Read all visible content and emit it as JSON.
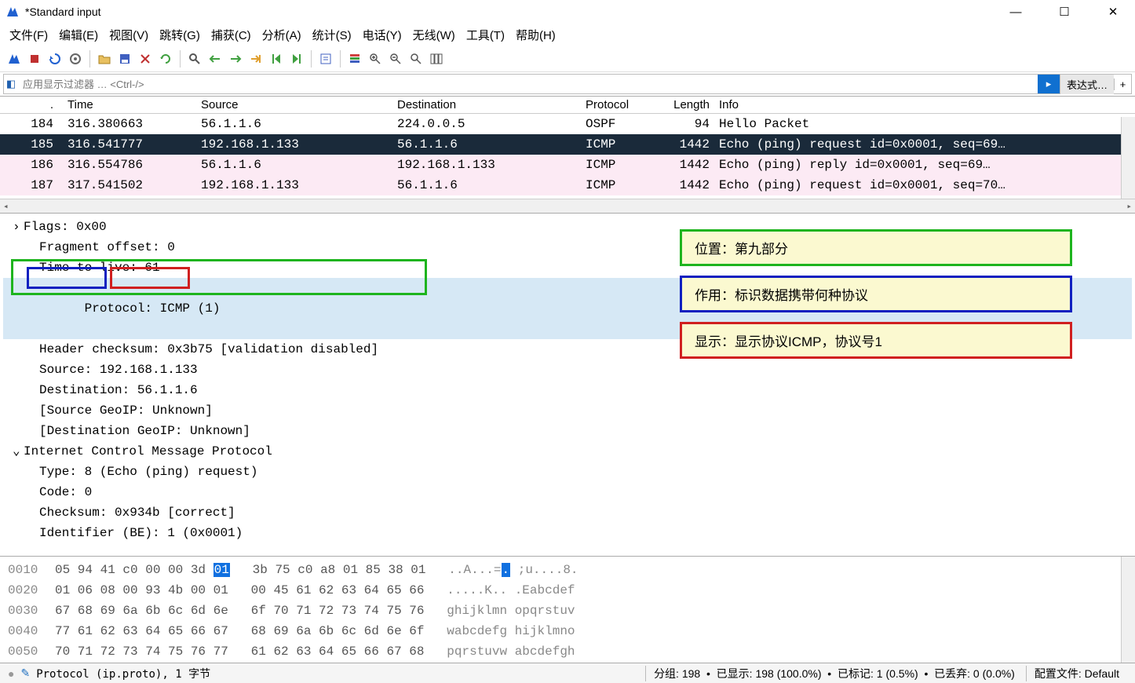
{
  "window": {
    "title": "*Standard input"
  },
  "menu": {
    "file": "文件(F)",
    "edit": "编辑(E)",
    "view": "视图(V)",
    "goto": "跳转(G)",
    "capture": "捕获(C)",
    "analyze": "分析(A)",
    "stats": "统计(S)",
    "telephony": "电话(Y)",
    "wireless": "无线(W)",
    "tools": "工具(T)",
    "help": "帮助(H)"
  },
  "filter": {
    "placeholder": "应用显示过滤器 … <Ctrl-/>",
    "expression": "表达式…"
  },
  "columns": {
    "no": "No.",
    "time": "Time",
    "source": "Source",
    "destination": "Destination",
    "protocol": "Protocol",
    "length": "Length",
    "info": "Info"
  },
  "packets": [
    {
      "no": "184",
      "time": "316.380663",
      "src": "56.1.1.6",
      "dst": "224.0.0.5",
      "proto": "OSPF",
      "len": "94",
      "info": "Hello Packet",
      "cls": "ospf"
    },
    {
      "no": "185",
      "time": "316.541777",
      "src": "192.168.1.133",
      "dst": "56.1.1.6",
      "proto": "ICMP",
      "len": "1442",
      "info": "Echo (ping) request  id=0x0001, seq=69…",
      "cls": "selected"
    },
    {
      "no": "186",
      "time": "316.554786",
      "src": "56.1.1.6",
      "dst": "192.168.1.133",
      "proto": "ICMP",
      "len": "1442",
      "info": "Echo (ping) reply    id=0x0001, seq=69…",
      "cls": "icmp"
    },
    {
      "no": "187",
      "time": "317.541502",
      "src": "192.168.1.133",
      "dst": "56.1.1.6",
      "proto": "ICMP",
      "len": "1442",
      "info": "Echo (ping) request  id=0x0001, seq=70…",
      "cls": "icmp"
    }
  ],
  "details": {
    "flags": "Flags: 0x00",
    "frag": "Fragment offset: 0",
    "ttl": "Time to live: 61",
    "proto_label": "Protocol: ",
    "proto_value": "ICMP (1)",
    "checksum": "Header checksum: 0x3b75 [validation disabled]",
    "source": "Source: 192.168.1.133",
    "dest": "Destination: 56.1.1.6",
    "srcgeo": "[Source GeoIP: Unknown]",
    "dstgeo": "[Destination GeoIP: Unknown]",
    "icmp_header": "Internet Control Message Protocol",
    "icmp_type": "Type: 8 (Echo (ping) request)",
    "icmp_code": "Code: 0",
    "icmp_checksum": "Checksum: 0x934b [correct]",
    "icmp_id": "Identifier (BE): 1 (0x0001)"
  },
  "annotations": {
    "position": "位置：第九部分",
    "function": "作用：标识数据携带何种协议",
    "display": "显示：显示协议ICMP，协议号1"
  },
  "hex": [
    {
      "off": "0010",
      "b1": "05 94 41 c0 00 00 3d ",
      "sel": "01",
      "b2": "   3b 75 c0 a8 01 85 38 01",
      "a1": "   ..A...=",
      "asel": ".",
      "a2": " ;u....8."
    },
    {
      "off": "0020",
      "b1": "01 06 08 00 93 4b 00 01   00 45 61 62 63 64 65 66",
      "a": "   .....K.. .Eabcdef"
    },
    {
      "off": "0030",
      "b1": "67 68 69 6a 6b 6c 6d 6e   6f 70 71 72 73 74 75 76",
      "a": "   ghijklmn opqrstuv"
    },
    {
      "off": "0040",
      "b1": "77 61 62 63 64 65 66 67   68 69 6a 6b 6c 6d 6e 6f",
      "a": "   wabcdefg hijklmno"
    },
    {
      "off": "0050",
      "b1": "70 71 72 73 74 75 76 77   61 62 63 64 65 66 67 68",
      "a": "   pqrstuvw abcdefgh"
    }
  ],
  "status": {
    "field": "Protocol (ip.proto), 1 字节",
    "packets": "分组: 198",
    "displayed": "已显示: 198 (100.0%)",
    "marked": "已标记: 1 (0.5%)",
    "dropped": "已丢弃: 0 (0.0%)",
    "profile": "配置文件: Default"
  }
}
